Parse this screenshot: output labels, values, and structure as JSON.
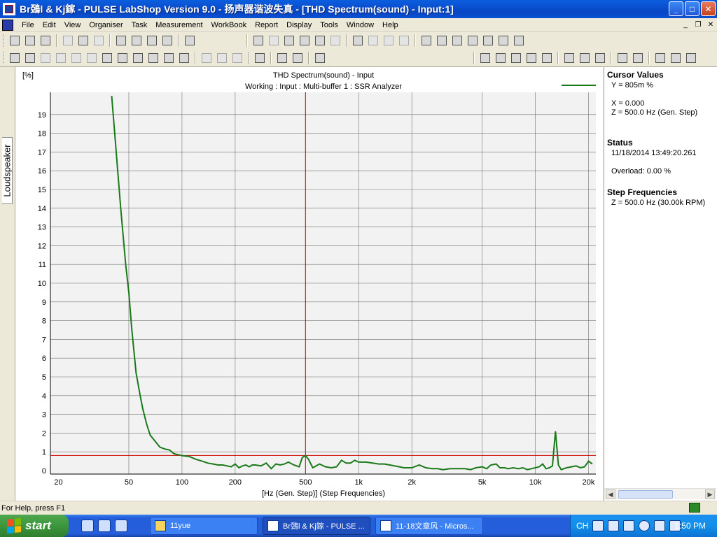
{
  "window": {
    "title": "Br鵶l & Kj鎵 - PULSE LabShop Version 9.0 - 扬声器谐波失真 - [THD Spectrum(sound) - Input:1]"
  },
  "menu": [
    "File",
    "Edit",
    "View",
    "Organiser",
    "Task",
    "Measurement",
    "WorkBook",
    "Report",
    "Display",
    "Tools",
    "Window",
    "Help"
  ],
  "left_tab": {
    "label": "Loudspeaker"
  },
  "chart_data": {
    "type": "line",
    "title": "THD Spectrum(sound) - Input",
    "subtitle": "Working : Input : Multi-buffer 1 : SSR Analyzer",
    "ylabel": "[%]",
    "xlabel": "[Hz (Gen. Step)] (Step Frequencies)",
    "xscale": "log",
    "xlim": [
      18,
      22000
    ],
    "ylim": [
      0,
      20
    ],
    "xticks": [
      {
        "value": 20,
        "label": "20"
      },
      {
        "value": 50,
        "label": "50"
      },
      {
        "value": 100,
        "label": "100"
      },
      {
        "value": 200,
        "label": "200"
      },
      {
        "value": 500,
        "label": "500"
      },
      {
        "value": 1000,
        "label": "1k"
      },
      {
        "value": 2000,
        "label": "2k"
      },
      {
        "value": 5000,
        "label": "5k"
      },
      {
        "value": 10000,
        "label": "10k"
      },
      {
        "value": 20000,
        "label": "20k"
      }
    ],
    "yticks": [
      0,
      1,
      2,
      3,
      4,
      5,
      6,
      7,
      8,
      9,
      10,
      11,
      12,
      13,
      14,
      15,
      16,
      17,
      18,
      19
    ],
    "grid": true,
    "line_color": "#1a7a1a",
    "cursor_color": "#cc0000",
    "cursor": {
      "x": 500,
      "y": 0.805
    },
    "series": [
      {
        "x": [
          40,
          42,
          45,
          48,
          50,
          52,
          55,
          58,
          60,
          63,
          66,
          70,
          75,
          80,
          85,
          90,
          95,
          100,
          110,
          120,
          130,
          140,
          150,
          160,
          170,
          180,
          190,
          200,
          210,
          220,
          230,
          240,
          250,
          260,
          280,
          300,
          320,
          340,
          360,
          380,
          400,
          430,
          460,
          480,
          500,
          520,
          550,
          600,
          650,
          700,
          750,
          800,
          850,
          900,
          950,
          1000,
          1100,
          1200,
          1300,
          1400,
          1500,
          1700,
          1800,
          2000,
          2200,
          2400,
          2600,
          2800,
          3000,
          3300,
          3600,
          4000,
          4300,
          4600,
          5000,
          5300,
          5600,
          6000,
          6300,
          6700,
          7000,
          7500,
          8000,
          8500,
          9000,
          9500,
          10000,
          10500,
          11000,
          11500,
          12000,
          12500,
          13000,
          13500,
          14000,
          15000,
          16000,
          17000,
          18000,
          19000,
          20000,
          21000
        ],
        "y": [
          20,
          17.5,
          14,
          11,
          9.5,
          7.5,
          5.2,
          4,
          3.3,
          2.5,
          1.9,
          1.6,
          1.25,
          1.15,
          1.1,
          0.9,
          0.85,
          0.8,
          0.75,
          0.6,
          0.5,
          0.4,
          0.35,
          0.3,
          0.3,
          0.25,
          0.2,
          0.35,
          0.15,
          0.25,
          0.3,
          0.2,
          0.3,
          0.3,
          0.25,
          0.4,
          0.1,
          0.35,
          0.3,
          0.35,
          0.45,
          0.3,
          0.2,
          0.7,
          0.8,
          0.6,
          0.15,
          0.35,
          0.2,
          0.15,
          0.2,
          0.55,
          0.4,
          0.4,
          0.55,
          0.45,
          0.45,
          0.4,
          0.35,
          0.35,
          0.3,
          0.2,
          0.15,
          0.15,
          0.3,
          0.15,
          0.1,
          0.1,
          0.05,
          0.1,
          0.1,
          0.1,
          0.05,
          0.15,
          0.2,
          0.1,
          0.3,
          0.35,
          0.15,
          0.15,
          0.1,
          0.15,
          0.1,
          0.15,
          0.05,
          0.1,
          0.15,
          0.2,
          0.35,
          0.1,
          0.15,
          0.25,
          2.1,
          0.3,
          0.05,
          0.15,
          0.2,
          0.25,
          0.15,
          0.2,
          0.5,
          0.35
        ]
      }
    ]
  },
  "panel": {
    "cursor_title": "Cursor Values",
    "cursor_y": "Y = 805m %",
    "cursor_x": "X = 0.000",
    "cursor_z": "Z = 500.0 Hz (Gen. Step)",
    "status_title": "Status",
    "status_time": "11/18/2014  13:49:20.261",
    "overload": "Overload:   0.00 %",
    "step_title": "Step Frequencies",
    "step_z": "Z = 500.0 Hz (30.00k RPM)"
  },
  "statusbar": {
    "text": "For Help, press F1"
  },
  "taskbar": {
    "start": "start",
    "tasks": [
      {
        "label": "11yue"
      },
      {
        "label": "Br鵶l & Kj鎵 - PULSE ..."
      },
      {
        "label": "11-18文章风 - Micros..."
      }
    ],
    "lang": "CH",
    "clock": "1:50 PM"
  }
}
